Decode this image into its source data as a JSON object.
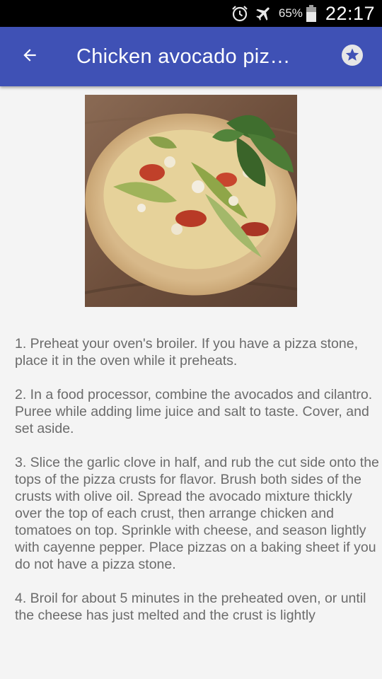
{
  "status_bar": {
    "battery_percent": "65%",
    "time": "22:17",
    "icons": [
      "alarm-icon",
      "airplane-mode-icon",
      "battery-icon"
    ]
  },
  "app_bar": {
    "title": "Chicken avocado pizza...",
    "back_icon": "arrow-back-icon",
    "favorite_icon": "star-icon",
    "color": "#3f51b5"
  },
  "recipe": {
    "image_description_icon": "pizza-photo",
    "steps": [
      "1. Preheat your oven's broiler. If you have a pizza stone, place it in the oven while it preheats.",
      "2. In a food processor, combine the avocados and cilantro. Puree while adding lime juice and salt to taste. Cover, and set aside.",
      "3. Slice the garlic clove in half, and rub the cut side onto the tops of the pizza crusts for flavor. Brush both sides of the crusts with olive oil. Spread the avocado mixture thickly over the top of each crust, then arrange chicken and tomatoes on top. Sprinkle with cheese, and season lightly with cayenne pepper. Place pizzas on a baking sheet if you do not have a pizza stone.",
      "4. Broil for about 5 minutes in the preheated oven, or until the cheese has just melted and the crust is lightly"
    ]
  }
}
